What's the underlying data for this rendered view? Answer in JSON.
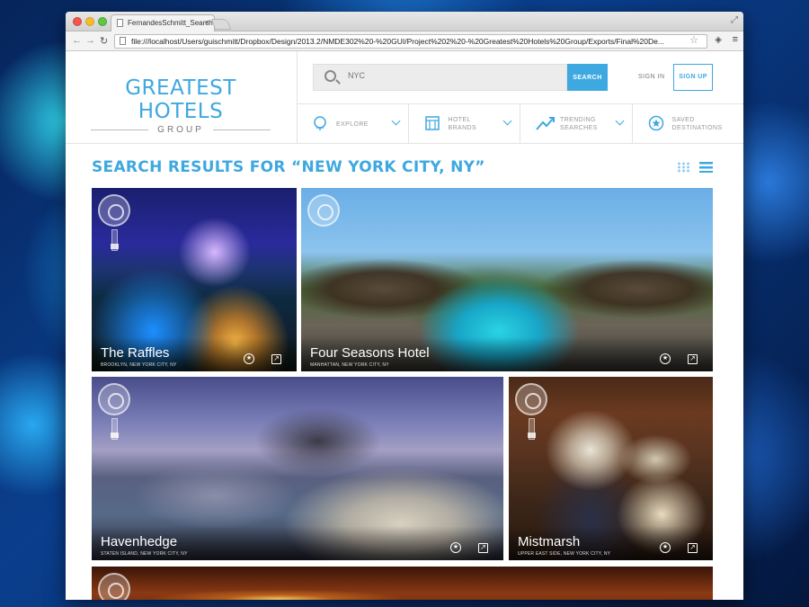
{
  "browser": {
    "tab_title": "FernandesSchmitt_SearchR",
    "url": "file:///localhost/Users/guischmitt/Dropbox/Design/2013.2/NMDE302%20-%20GUI/Project%202%20-%20Greatest%20Hotels%20Group/Exports/Final%20De..."
  },
  "header": {
    "logo_main": "GREATEST HOTELS",
    "logo_sub": "GROUP",
    "search_placeholder": "NYC",
    "search_button": "SEARCH",
    "sign_in": "SIGN IN",
    "sign_up": "SIGN UP",
    "nav": [
      {
        "label": "EXPLORE",
        "icon": "globe-icon"
      },
      {
        "label": "HOTEL BRANDS",
        "line1": "HOTEL",
        "line2": "BRANDS",
        "icon": "building-icon"
      },
      {
        "label": "TRENDING SEARCHES",
        "line1": "TRENDING",
        "line2": "SEARCHES",
        "icon": "trending-icon"
      },
      {
        "label": "SAVED DESTINATIONS",
        "line1": "SAVED",
        "line2": "DESTINATIONS",
        "icon": "star-circle-icon"
      }
    ]
  },
  "results": {
    "title": "SEARCH RESULTS FOR “NEW YORK CITY, NY”",
    "hotels": [
      {
        "name": "The Raffles",
        "location": "BROOKLYN, NEW YORK CITY, NY"
      },
      {
        "name": "Four Seasons Hotel",
        "location": "MANHATTAN, NEW YORK CITY, NY"
      },
      {
        "name": "Havenhedge",
        "location": "STATEN ISLAND, NEW YORK CITY, NY"
      },
      {
        "name": "Mistmarsh",
        "location": "UPPER EAST SIDE, NEW YORK CITY, NY"
      }
    ]
  },
  "colors": {
    "accent": "#3ea8e0"
  }
}
